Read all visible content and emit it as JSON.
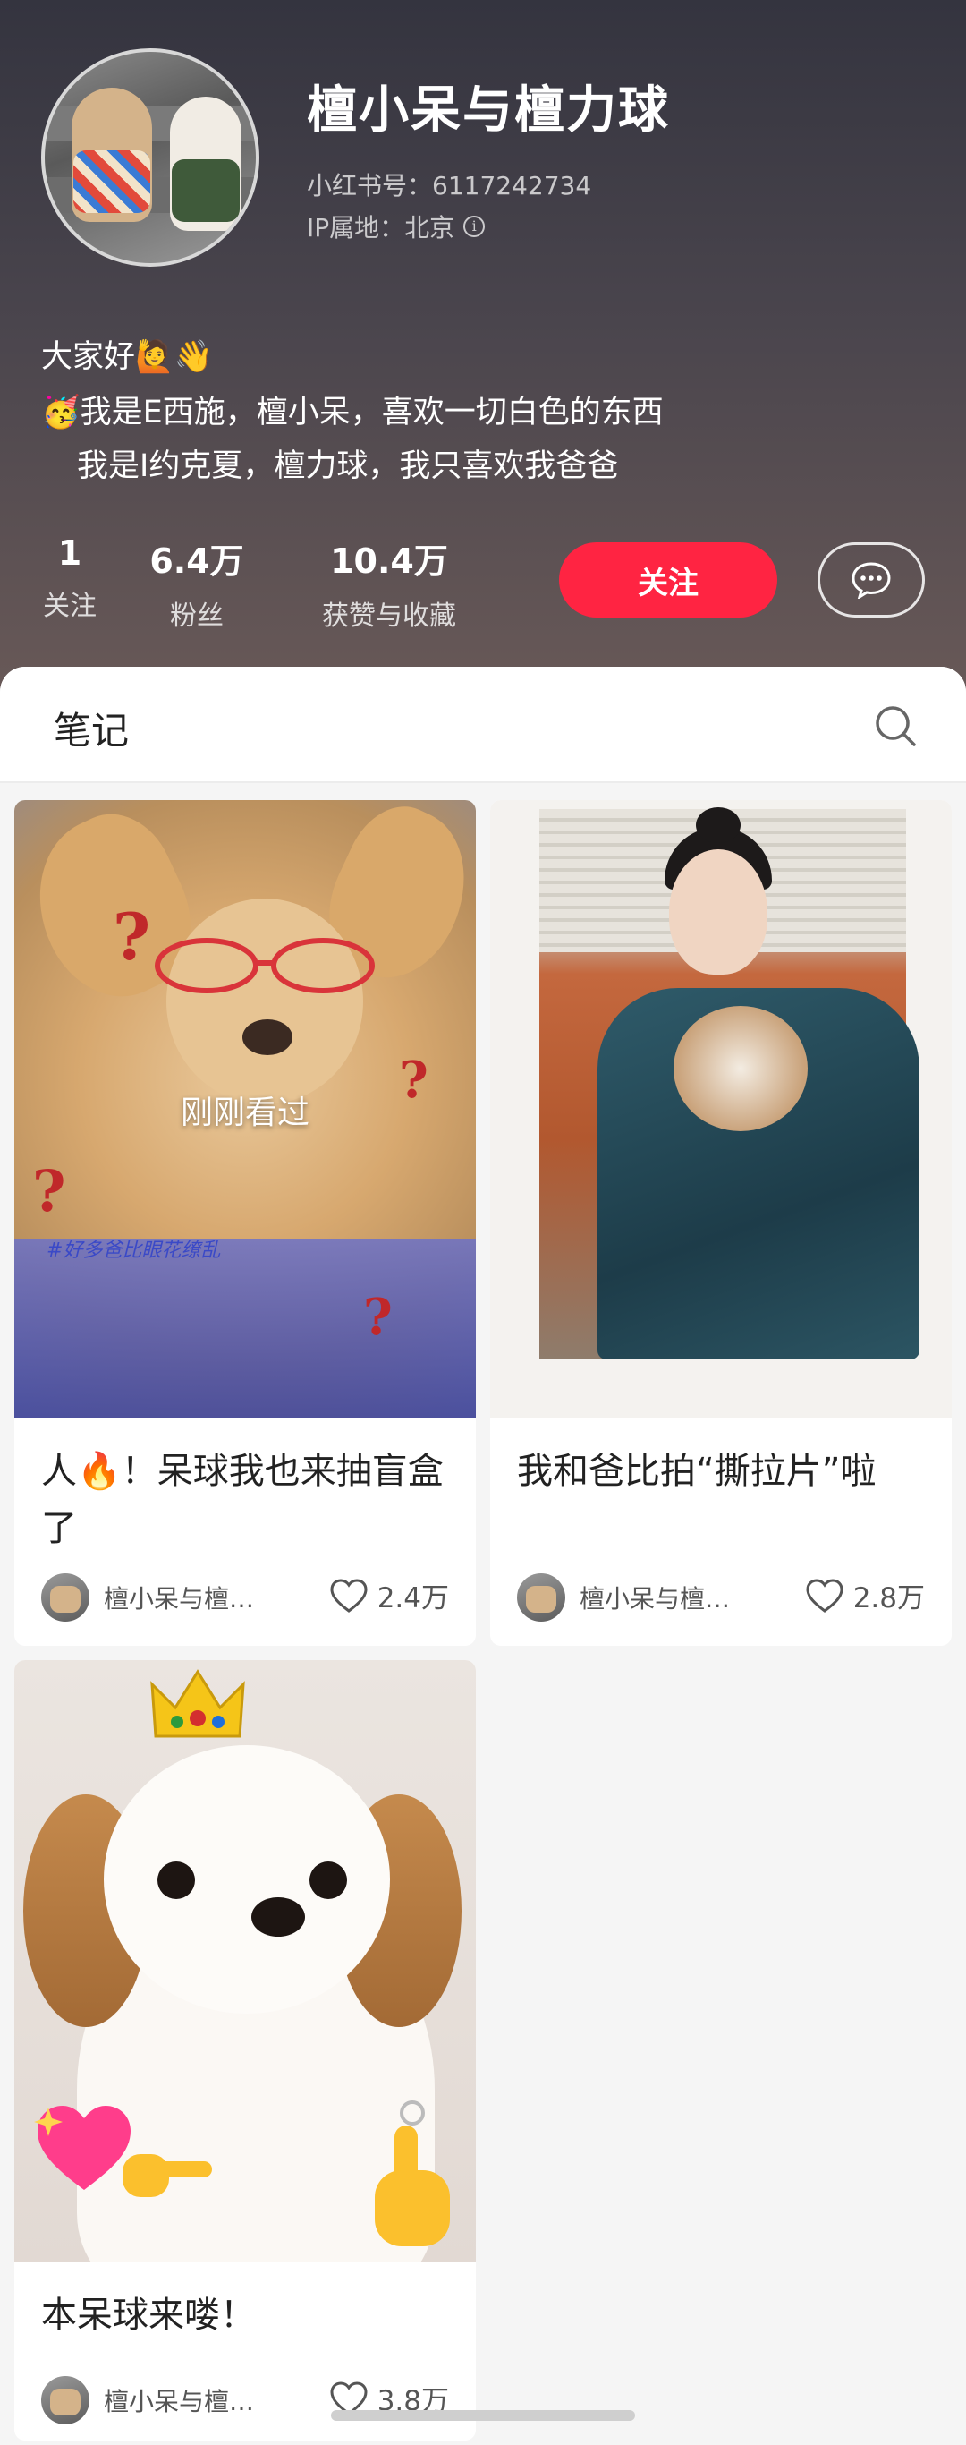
{
  "profile": {
    "name": "檀小呆与檀力球",
    "red_id": "小红书号：6117242734",
    "ip_location": "IP属地：北京",
    "bio": [
      "大家好🙋👋",
      "🥳我是E西施，檀小呆，喜欢一切白色的东西",
      "我是I约克夏，檀力球，我只喜欢我爸爸"
    ],
    "stats": [
      {
        "value": "1",
        "label": "关注"
      },
      {
        "value": "6.4万",
        "label": "粉丝"
      },
      {
        "value": "10.4万",
        "label": "获赞与收藏"
      }
    ],
    "follow_label": "关注"
  },
  "tabs": {
    "notes_label": "笔记"
  },
  "notes": [
    {
      "title": "人🔥！呆球我也来抽盲盒了",
      "overlay": "刚刚看过",
      "image_tag": "#好多爸比眼花缭乱",
      "author": "檀小呆与檀…",
      "likes": "2.4万"
    },
    {
      "title": "我和爸比拍“撕拉片”啦",
      "author": "檀小呆与檀…",
      "likes": "2.8万"
    },
    {
      "title": "本呆球来喽！",
      "author": "檀小呆与檀…",
      "likes": "3.8万"
    }
  ],
  "colors": {
    "accent": "#ff2442",
    "header_top": "#34343f",
    "header_bottom": "#6a5a58"
  },
  "icons": [
    "info-icon",
    "message-icon",
    "search-icon",
    "heart-icon"
  ]
}
